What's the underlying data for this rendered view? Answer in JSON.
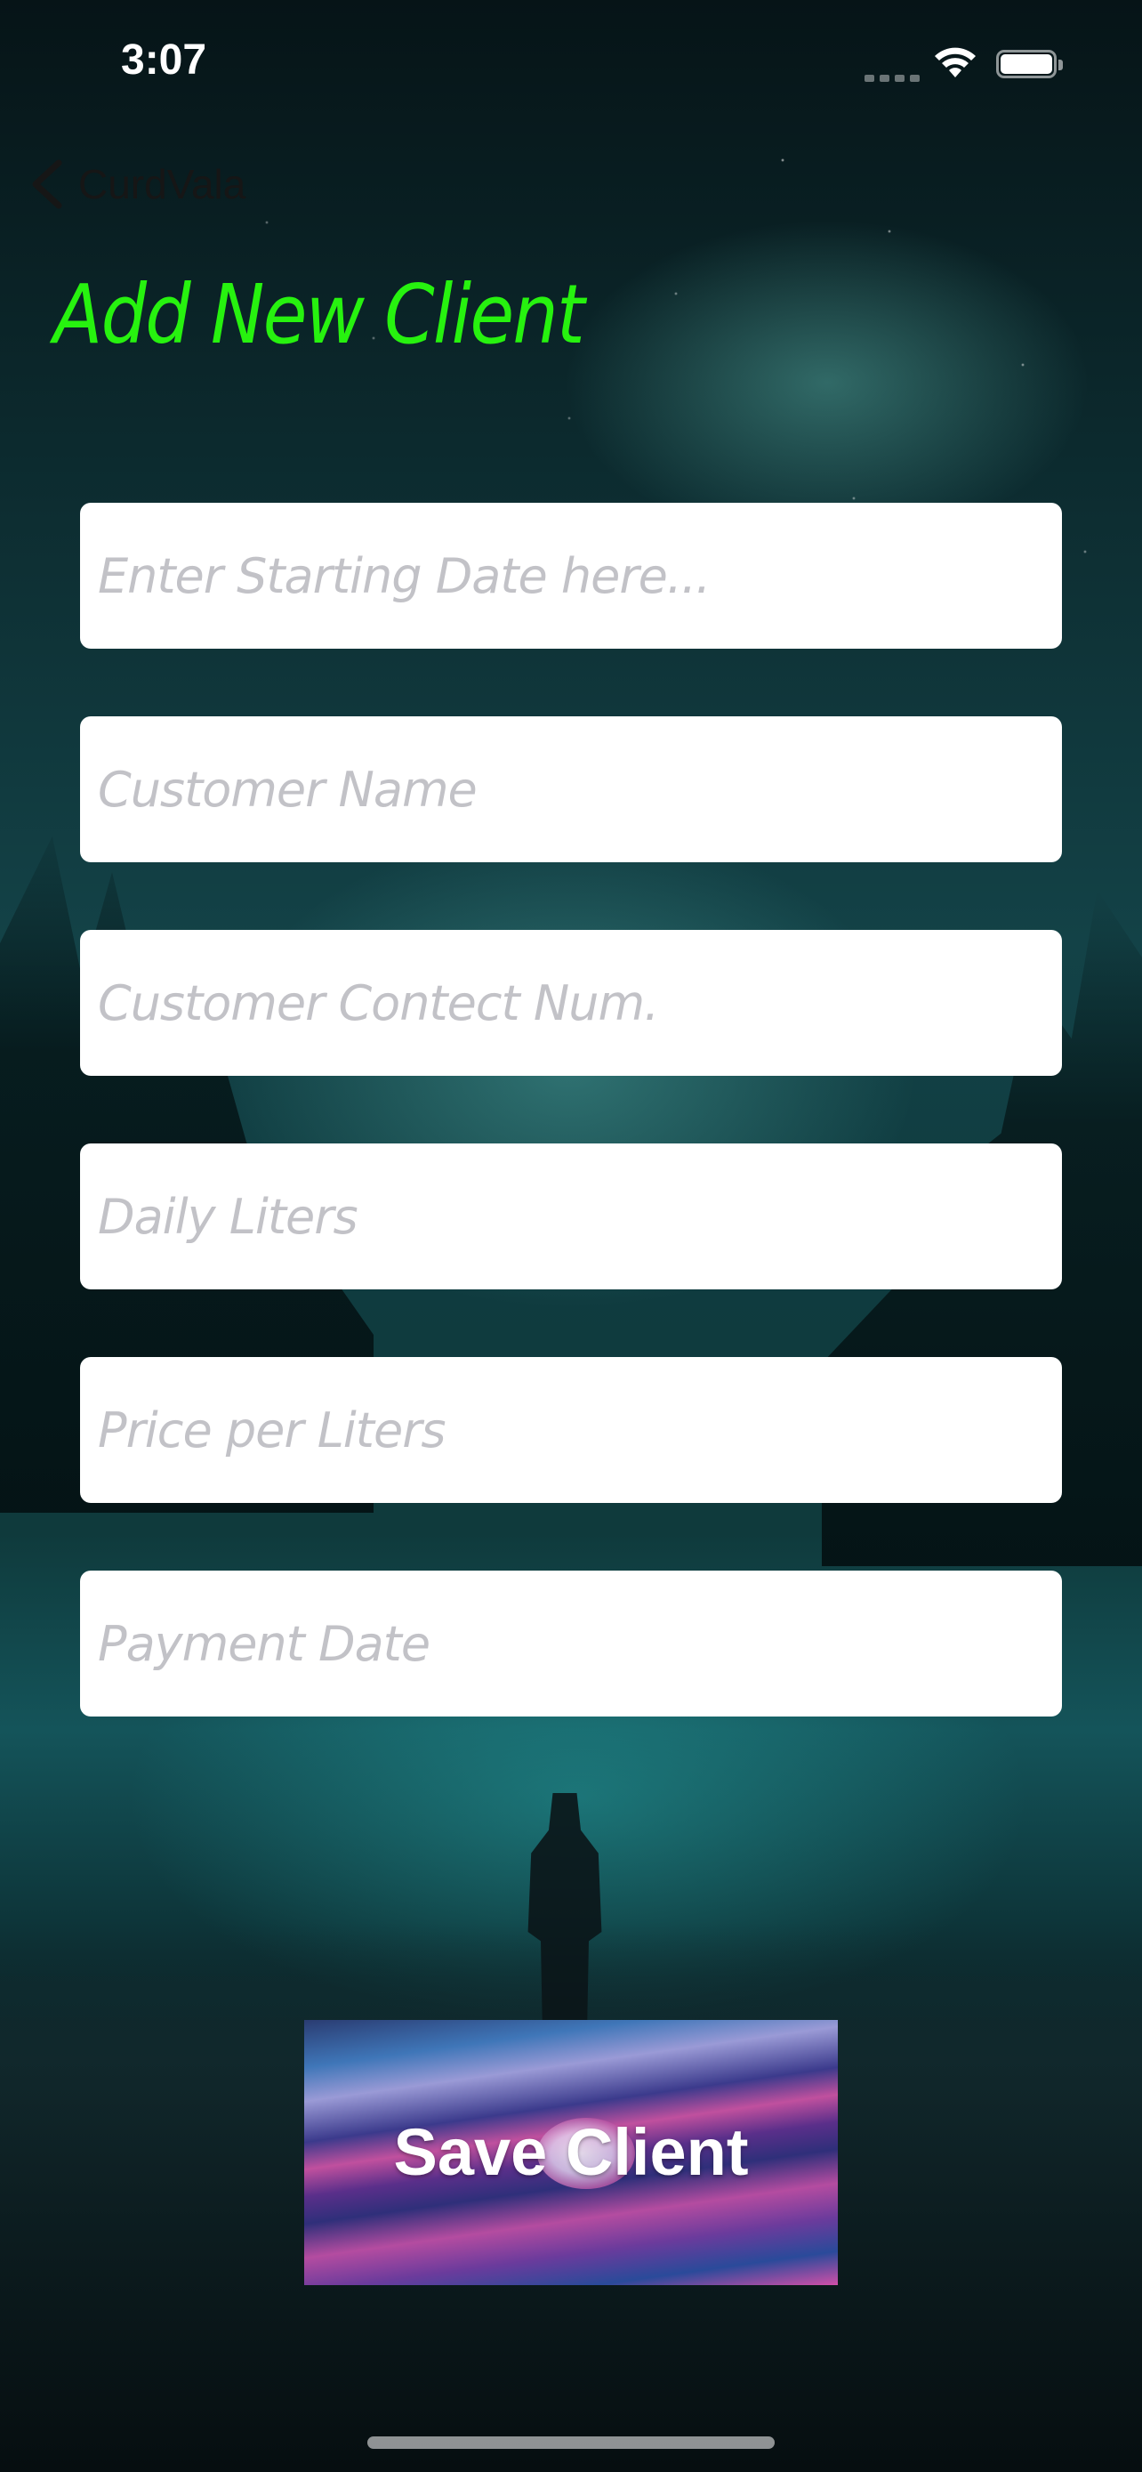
{
  "status_bar": {
    "time": "3:07"
  },
  "nav": {
    "back_label": "CurdVala"
  },
  "page": {
    "title": "Add New Client"
  },
  "form": {
    "fields": [
      {
        "placeholder": "Enter Starting Date here...",
        "value": ""
      },
      {
        "placeholder": "Customer Name",
        "value": ""
      },
      {
        "placeholder": "Customer Contect Num.",
        "value": ""
      },
      {
        "placeholder": "Daily Liters",
        "value": ""
      },
      {
        "placeholder": "Price per Liters",
        "value": ""
      },
      {
        "placeholder": "Payment Date",
        "value": ""
      }
    ]
  },
  "actions": {
    "save_label": "Save Client"
  },
  "colors": {
    "title": "#27f20f",
    "field_bg": "#ffffff",
    "placeholder": "#c2c2c7"
  },
  "icons": {
    "back": "chevron-left-icon",
    "wifi": "wifi-icon",
    "battery": "battery-icon",
    "signal": "cellular-signal-icon"
  }
}
